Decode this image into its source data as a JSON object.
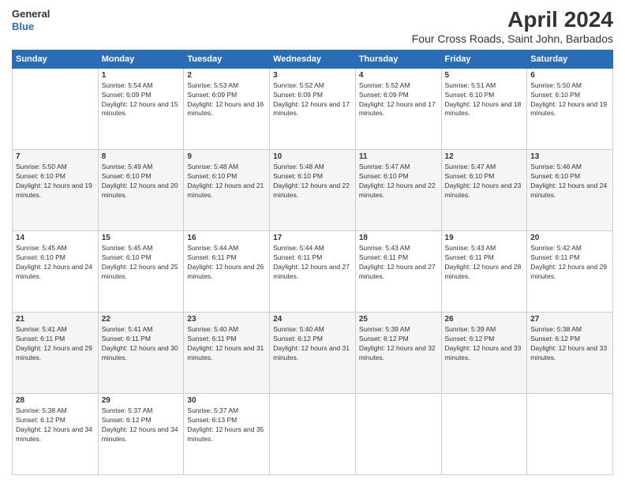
{
  "logo": {
    "line1": "General",
    "line2": "Blue"
  },
  "title": "April 2024",
  "location": "Four Cross Roads, Saint John, Barbados",
  "headers": [
    "Sunday",
    "Monday",
    "Tuesday",
    "Wednesday",
    "Thursday",
    "Friday",
    "Saturday"
  ],
  "weeks": [
    [
      {
        "day": "",
        "sunrise": "",
        "sunset": "",
        "daylight": ""
      },
      {
        "day": "1",
        "sunrise": "Sunrise: 5:54 AM",
        "sunset": "Sunset: 6:09 PM",
        "daylight": "Daylight: 12 hours and 15 minutes."
      },
      {
        "day": "2",
        "sunrise": "Sunrise: 5:53 AM",
        "sunset": "Sunset: 6:09 PM",
        "daylight": "Daylight: 12 hours and 16 minutes."
      },
      {
        "day": "3",
        "sunrise": "Sunrise: 5:52 AM",
        "sunset": "Sunset: 6:09 PM",
        "daylight": "Daylight: 12 hours and 17 minutes."
      },
      {
        "day": "4",
        "sunrise": "Sunrise: 5:52 AM",
        "sunset": "Sunset: 6:09 PM",
        "daylight": "Daylight: 12 hours and 17 minutes."
      },
      {
        "day": "5",
        "sunrise": "Sunrise: 5:51 AM",
        "sunset": "Sunset: 6:10 PM",
        "daylight": "Daylight: 12 hours and 18 minutes."
      },
      {
        "day": "6",
        "sunrise": "Sunrise: 5:50 AM",
        "sunset": "Sunset: 6:10 PM",
        "daylight": "Daylight: 12 hours and 19 minutes."
      }
    ],
    [
      {
        "day": "7",
        "sunrise": "Sunrise: 5:50 AM",
        "sunset": "Sunset: 6:10 PM",
        "daylight": "Daylight: 12 hours and 19 minutes."
      },
      {
        "day": "8",
        "sunrise": "Sunrise: 5:49 AM",
        "sunset": "Sunset: 6:10 PM",
        "daylight": "Daylight: 12 hours and 20 minutes."
      },
      {
        "day": "9",
        "sunrise": "Sunrise: 5:48 AM",
        "sunset": "Sunset: 6:10 PM",
        "daylight": "Daylight: 12 hours and 21 minutes."
      },
      {
        "day": "10",
        "sunrise": "Sunrise: 5:48 AM",
        "sunset": "Sunset: 6:10 PM",
        "daylight": "Daylight: 12 hours and 22 minutes."
      },
      {
        "day": "11",
        "sunrise": "Sunrise: 5:47 AM",
        "sunset": "Sunset: 6:10 PM",
        "daylight": "Daylight: 12 hours and 22 minutes."
      },
      {
        "day": "12",
        "sunrise": "Sunrise: 5:47 AM",
        "sunset": "Sunset: 6:10 PM",
        "daylight": "Daylight: 12 hours and 23 minutes."
      },
      {
        "day": "13",
        "sunrise": "Sunrise: 5:46 AM",
        "sunset": "Sunset: 6:10 PM",
        "daylight": "Daylight: 12 hours and 24 minutes."
      }
    ],
    [
      {
        "day": "14",
        "sunrise": "Sunrise: 5:45 AM",
        "sunset": "Sunset: 6:10 PM",
        "daylight": "Daylight: 12 hours and 24 minutes."
      },
      {
        "day": "15",
        "sunrise": "Sunrise: 5:45 AM",
        "sunset": "Sunset: 6:10 PM",
        "daylight": "Daylight: 12 hours and 25 minutes."
      },
      {
        "day": "16",
        "sunrise": "Sunrise: 5:44 AM",
        "sunset": "Sunset: 6:11 PM",
        "daylight": "Daylight: 12 hours and 26 minutes."
      },
      {
        "day": "17",
        "sunrise": "Sunrise: 5:44 AM",
        "sunset": "Sunset: 6:11 PM",
        "daylight": "Daylight: 12 hours and 27 minutes."
      },
      {
        "day": "18",
        "sunrise": "Sunrise: 5:43 AM",
        "sunset": "Sunset: 6:11 PM",
        "daylight": "Daylight: 12 hours and 27 minutes."
      },
      {
        "day": "19",
        "sunrise": "Sunrise: 5:43 AM",
        "sunset": "Sunset: 6:11 PM",
        "daylight": "Daylight: 12 hours and 28 minutes."
      },
      {
        "day": "20",
        "sunrise": "Sunrise: 5:42 AM",
        "sunset": "Sunset: 6:11 PM",
        "daylight": "Daylight: 12 hours and 29 minutes."
      }
    ],
    [
      {
        "day": "21",
        "sunrise": "Sunrise: 5:41 AM",
        "sunset": "Sunset: 6:11 PM",
        "daylight": "Daylight: 12 hours and 29 minutes."
      },
      {
        "day": "22",
        "sunrise": "Sunrise: 5:41 AM",
        "sunset": "Sunset: 6:11 PM",
        "daylight": "Daylight: 12 hours and 30 minutes."
      },
      {
        "day": "23",
        "sunrise": "Sunrise: 5:40 AM",
        "sunset": "Sunset: 6:11 PM",
        "daylight": "Daylight: 12 hours and 31 minutes."
      },
      {
        "day": "24",
        "sunrise": "Sunrise: 5:40 AM",
        "sunset": "Sunset: 6:12 PM",
        "daylight": "Daylight: 12 hours and 31 minutes."
      },
      {
        "day": "25",
        "sunrise": "Sunrise: 5:39 AM",
        "sunset": "Sunset: 6:12 PM",
        "daylight": "Daylight: 12 hours and 32 minutes."
      },
      {
        "day": "26",
        "sunrise": "Sunrise: 5:39 AM",
        "sunset": "Sunset: 6:12 PM",
        "daylight": "Daylight: 12 hours and 33 minutes."
      },
      {
        "day": "27",
        "sunrise": "Sunrise: 5:38 AM",
        "sunset": "Sunset: 6:12 PM",
        "daylight": "Daylight: 12 hours and 33 minutes."
      }
    ],
    [
      {
        "day": "28",
        "sunrise": "Sunrise: 5:38 AM",
        "sunset": "Sunset: 6:12 PM",
        "daylight": "Daylight: 12 hours and 34 minutes."
      },
      {
        "day": "29",
        "sunrise": "Sunrise: 5:37 AM",
        "sunset": "Sunset: 6:12 PM",
        "daylight": "Daylight: 12 hours and 34 minutes."
      },
      {
        "day": "30",
        "sunrise": "Sunrise: 5:37 AM",
        "sunset": "Sunset: 6:13 PM",
        "daylight": "Daylight: 12 hours and 35 minutes."
      },
      {
        "day": "",
        "sunrise": "",
        "sunset": "",
        "daylight": ""
      },
      {
        "day": "",
        "sunrise": "",
        "sunset": "",
        "daylight": ""
      },
      {
        "day": "",
        "sunrise": "",
        "sunset": "",
        "daylight": ""
      },
      {
        "day": "",
        "sunrise": "",
        "sunset": "",
        "daylight": ""
      }
    ]
  ]
}
